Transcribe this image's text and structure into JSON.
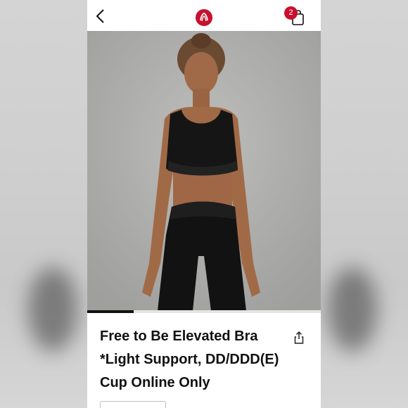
{
  "header": {
    "back_icon": "chevron-left-icon",
    "logo_icon": "lululemon-logo-icon",
    "bag_icon": "shopping-bag-icon",
    "bag_count": "2",
    "brand_color": "#c8102e"
  },
  "hero": {
    "image": "model wearing black sports bra and black leggings",
    "slide_progress": 0.2
  },
  "product": {
    "title_line1": "Free to Be Elevated Bra",
    "title_line2": "*Light Support, DD/DDD(E)",
    "title_line3": "Cup Online Only",
    "share_icon": "share-icon"
  }
}
